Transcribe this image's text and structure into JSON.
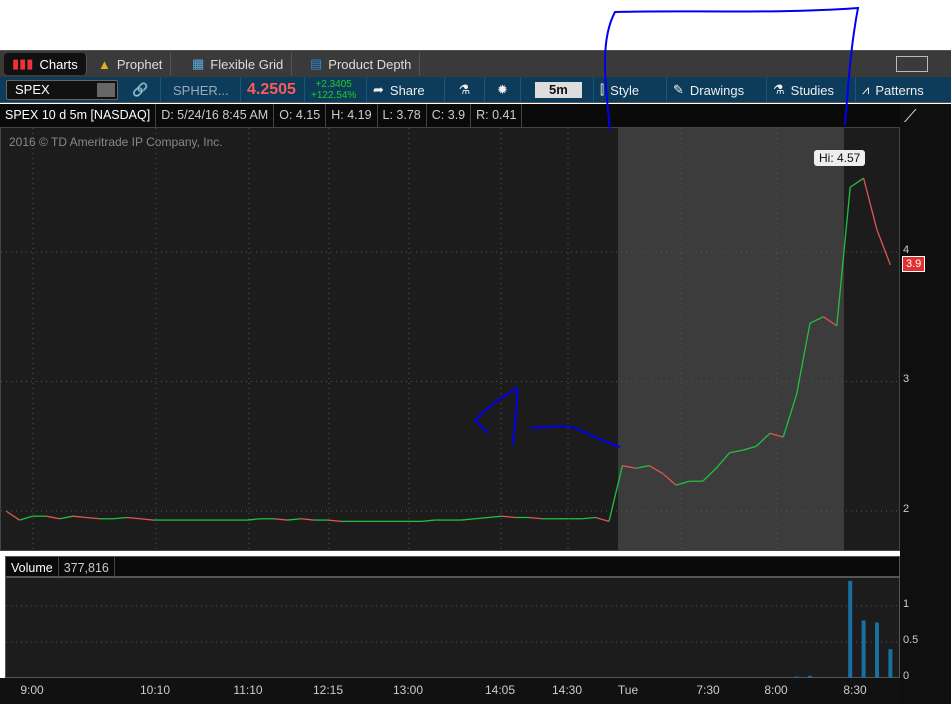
{
  "tabs": [
    {
      "label": "Charts",
      "icon": "bar-chart-icon"
    },
    {
      "label": "Prophet",
      "icon": "prophet-eye-icon"
    },
    {
      "label": "Flexible Grid",
      "icon": "grid-icon"
    },
    {
      "label": "Product Depth",
      "icon": "depth-chart-icon"
    }
  ],
  "toolbar": {
    "symbol": "SPEX",
    "company": "SPHER...",
    "last": "4.2505",
    "change": "+2.3405",
    "change_pct": "+122.54%",
    "share": "Share",
    "timeframe": "5m",
    "style": "Style",
    "drawings": "Drawings",
    "studies": "Studies",
    "patterns": "Patterns"
  },
  "info": {
    "title": "SPEX 10 d 5m [NASDAQ]",
    "date": "D: 5/24/16 8:45 AM",
    "open": "O: 4.15",
    "high": "H: 4.19",
    "low": "L: 3.78",
    "close": "C: 3.9",
    "range": "R: 0.41"
  },
  "copyright": "2016 © TD Ameritrade IP Company, Inc.",
  "hi_bubble": "Hi: 4.57",
  "last_price_tag": "3.9",
  "volume": {
    "label": "Volume",
    "value": "377,816"
  },
  "colors": {
    "up": "#22c040",
    "down": "#e05555",
    "volume": "#1a6fa0",
    "toolbar": "#0c3c5a",
    "last": "#ff5a5a"
  },
  "chart_data": {
    "type": "line",
    "price_ticks": [
      "2",
      "3",
      "4"
    ],
    "volume_ticks": [
      "1",
      "0.5",
      "0"
    ],
    "time_labels": [
      "9:00",
      "10:10",
      "11:10",
      "12:15",
      "13:00",
      "14:05",
      "14:30",
      "Tue",
      "7:30",
      "8:00",
      "8:30"
    ],
    "price": [
      2.0,
      1.93,
      1.96,
      1.96,
      1.94,
      1.96,
      1.95,
      1.94,
      1.94,
      1.95,
      1.94,
      1.93,
      1.93,
      1.93,
      1.93,
      1.93,
      1.93,
      1.93,
      1.93,
      1.94,
      1.94,
      1.93,
      1.94,
      1.93,
      1.93,
      1.92,
      1.92,
      1.92,
      1.92,
      1.92,
      1.92,
      1.92,
      1.93,
      1.93,
      1.93,
      1.94,
      1.95,
      1.96,
      1.95,
      1.95,
      1.94,
      1.94,
      1.94,
      1.94,
      1.95,
      1.92,
      2.35,
      2.33,
      2.35,
      2.29,
      2.2,
      2.23,
      2.23,
      2.33,
      2.45,
      2.47,
      2.5,
      2.6,
      2.57,
      2.9,
      3.45,
      3.5,
      3.43,
      4.5,
      4.57,
      4.17,
      3.9
    ],
    "volume_millions": {
      "59": 0.02,
      "60": 0.03,
      "63": 1.35,
      "64": 0.8,
      "65": 0.77,
      "66": 0.4
    },
    "ylim": [
      1.8,
      4.8
    ]
  }
}
